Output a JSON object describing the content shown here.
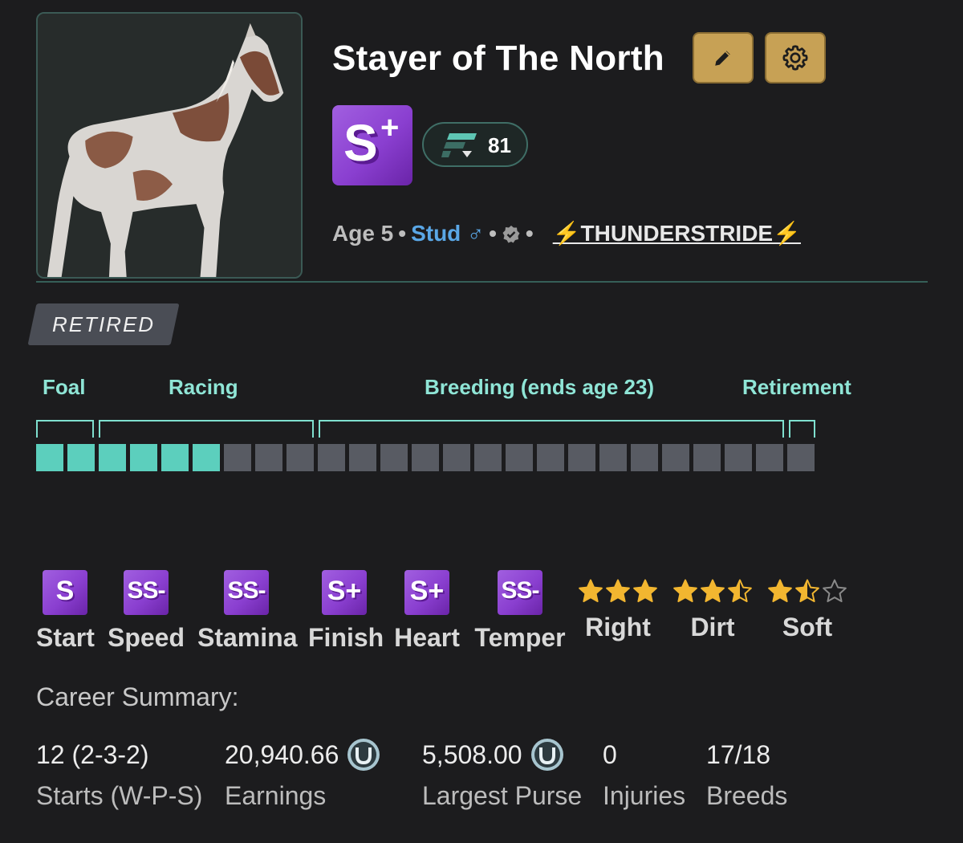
{
  "horse": {
    "name": "Stayer of The North",
    "grade": "S",
    "grade_plus": "+",
    "rating": "81",
    "age": "Age 5",
    "role": "Stud",
    "gender_symbol": "♂",
    "stable": "⚡THUNDERSTRIDE⚡",
    "status": "RETIRED"
  },
  "buttons": {
    "edit_icon": "pencil-icon",
    "settings_icon": "gear-icon"
  },
  "lifecycle": {
    "phases": [
      "Foal",
      "Racing",
      "Breeding (ends age 23)",
      "Retirement"
    ],
    "total_years": 25,
    "filled_years": 6,
    "filled_color": "#5ccfbd",
    "empty_color": "#585b63"
  },
  "stats": [
    {
      "grade": "S",
      "label": "Start"
    },
    {
      "grade": "SS-",
      "label": "Speed"
    },
    {
      "grade": "SS-",
      "label": "Stamina"
    },
    {
      "grade": "S+",
      "label": "Finish"
    },
    {
      "grade": "S+",
      "label": "Heart"
    },
    {
      "grade": "SS-",
      "label": "Temper"
    }
  ],
  "preferences": [
    {
      "label": "Right",
      "stars": 3
    },
    {
      "label": "Dirt",
      "stars": 2.5
    },
    {
      "label": "Soft",
      "stars": 1.5
    }
  ],
  "career": {
    "title": "Career Summary:",
    "starts_value": "12 (2-3-2)",
    "starts_label": "Starts (W-P-S)",
    "earnings_value": "20,940.66",
    "earnings_label": "Earnings",
    "largest_purse_value": "5,508.00",
    "largest_purse_label": "Largest Purse",
    "injuries_value": "0",
    "injuries_label": "Injuries",
    "breeds_value": "17/18",
    "breeds_label": "Breeds"
  }
}
